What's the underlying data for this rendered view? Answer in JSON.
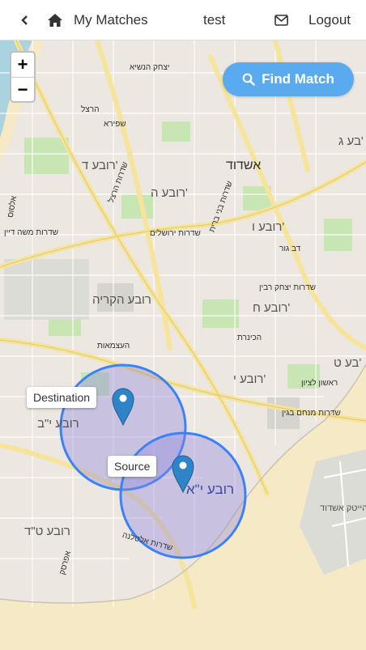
{
  "nav": {
    "back_label": "<",
    "my_matches": "My Matches",
    "username": "test",
    "logout": "Logout"
  },
  "map": {
    "zoom_in": "+",
    "zoom_out": "−",
    "find_match": "Find Match",
    "markers": {
      "destination": "Destination",
      "source": "Source"
    },
    "place_labels": {
      "ashdod": "אשדוד",
      "rova_heh": "רובע ה'",
      "rova_dalet": "רובע ד'",
      "rova_vav": "רובע ו'",
      "rova_kirya": "רובע הקריה",
      "rova_chet": "רובע ח'",
      "rova_yud": "רובע י'",
      "rova_yud_bet": "רובע י\"ב",
      "rova_yud_alef": "רובע י\"א",
      "rova_tet_dalet": "רובע ט\"ד",
      "rova_tet": "בע ט'",
      "rova_gimel": "בע ג'",
      "park_hitech": "פארק הייטק אשדוד"
    },
    "street_labels": {
      "s1": "שדרות ירושלים",
      "s2": "שדרות בני ברית",
      "s3": "שדרות מנחם בגין",
      "s4": "שדרות הרצל",
      "s5": "שדרות אלטלנה",
      "s6": "יצחק הנשיא",
      "s7": "שדרות יצחק רבין",
      "s8": "שדרות משה דיין",
      "s9": "ראשון לציון",
      "s10": "העצמאות",
      "s11": "אפרסק",
      "s12": "הכינרת",
      "s13": "דב גור",
      "s14": "שפירא",
      "s15": "הרצל",
      "s16": "אלסוס"
    }
  },
  "colors": {
    "circle_stroke": "#3b82f6",
    "circle_fill": "#8e86e0",
    "marker": "#2f84c8",
    "button": "#5aaaf0"
  }
}
